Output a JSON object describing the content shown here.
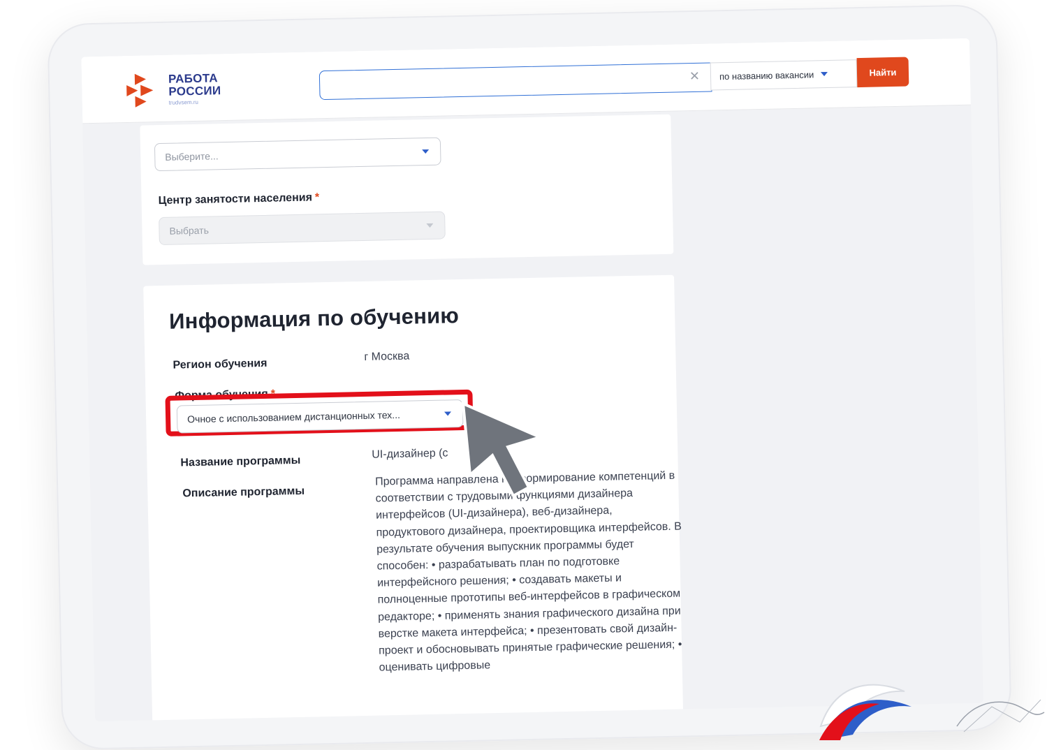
{
  "logo": {
    "line1": "РАБОТА",
    "line2": "РОССИИ",
    "domain": "trudvsem.ru"
  },
  "search": {
    "value": "",
    "mode_label": "по названию вакансии",
    "button_label": "Найти"
  },
  "filters": {
    "top_select_placeholder": "Выберите...",
    "employment_center_label": "Центр занятости населения",
    "employment_center_placeholder": "Выбрать"
  },
  "training": {
    "heading": "Информация по обучению",
    "region_label": "Регион обучения",
    "region_value": "г Москва",
    "form_label": "Форма обучения",
    "form_value": "Очное с использованием дистанционных тех...",
    "program_name_label": "Название программы",
    "program_name_value": "UI-дизайнер (с",
    "program_desc_label": "Описание программы",
    "program_desc_value": "Программа направлена на формирование компетенций в соответствии с трудовыми функциями дизайнера интерфейсов (UI-дизайнера), веб-дизайнера, продуктового дизайнера, проектировщика интерфейсов. В результате обучения выпускник программы будет способен: • разрабатывать план по подготовке интерфейсного решения; • создавать макеты и полноценные прототипы веб-интерфейсов в графическом редакторе; • применять знания графического дизайна при верстке макета интерфейса; • презентовать свой дизайн-проект и обосновывать принятые графические решения; • оценивать цифровые"
  },
  "colors": {
    "accent_blue": "#2f6fd6",
    "find_button": "#e0481d",
    "highlight": "#e3101a",
    "logo_blue": "#2b3a8c",
    "logo_red": "#e0481d"
  }
}
